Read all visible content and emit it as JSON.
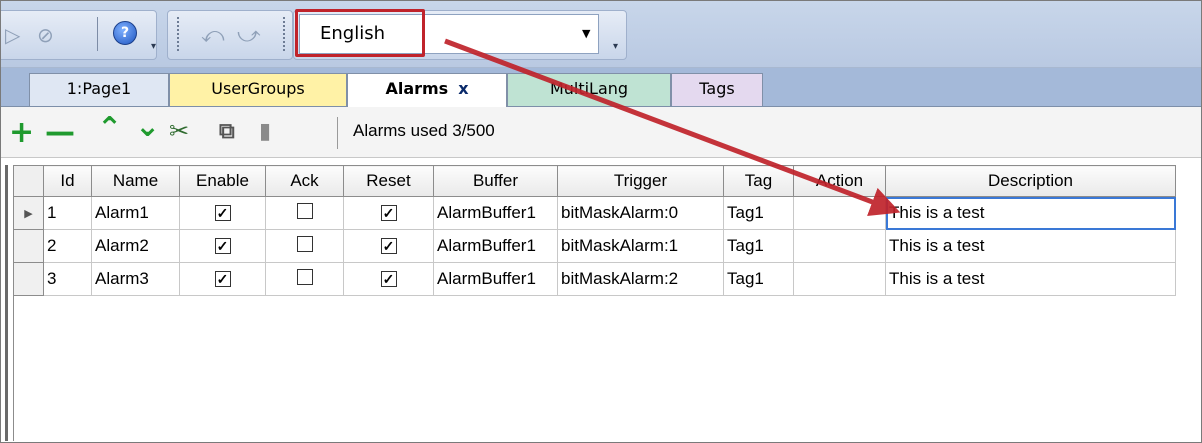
{
  "toolbar": {
    "language_selected": "English",
    "icons": [
      "play-icon",
      "no-entry-icon",
      "help-icon",
      "undo-icon",
      "redo-icon",
      "dropdown-arrow-icon"
    ]
  },
  "tabs": [
    {
      "label": "1:Page1",
      "color": "#dfe7f3"
    },
    {
      "label": "UserGroups",
      "color": "#fff2a6"
    },
    {
      "label": "Alarms",
      "color": "#ffffff",
      "active": true,
      "close": "x"
    },
    {
      "label": "MultiLang",
      "color": "#bfe3d3"
    },
    {
      "label": "Tags",
      "color": "#e4d9ef"
    }
  ],
  "grid_toolbar": {
    "icons": [
      "plus-icon",
      "minus-icon",
      "up-icon",
      "down-icon",
      "cut-icon",
      "copy-icon",
      "paste-icon"
    ],
    "status": "Alarms used 3/500"
  },
  "table": {
    "columns": [
      "Id",
      "Name",
      "Enable",
      "Ack",
      "Reset",
      "Buffer",
      "Trigger",
      "Tag",
      "Action",
      "Description"
    ],
    "rows": [
      {
        "id": "1",
        "name": "Alarm1",
        "enable": true,
        "ack": false,
        "reset": true,
        "buffer": "AlarmBuffer1",
        "trigger": "bitMaskAlarm:0",
        "tag": "Tag1",
        "action": "",
        "description": "This is a test"
      },
      {
        "id": "2",
        "name": "Alarm2",
        "enable": true,
        "ack": false,
        "reset": true,
        "buffer": "AlarmBuffer1",
        "trigger": "bitMaskAlarm:1",
        "tag": "Tag1",
        "action": "",
        "description": "This is a test"
      },
      {
        "id": "3",
        "name": "Alarm3",
        "enable": true,
        "ack": false,
        "reset": true,
        "buffer": "AlarmBuffer1",
        "trigger": "bitMaskAlarm:2",
        "tag": "Tag1",
        "action": "",
        "description": "This is a test"
      }
    ]
  },
  "annotation": {
    "highlight_color": "#c0232b",
    "arrow_color": "#c0232b"
  }
}
